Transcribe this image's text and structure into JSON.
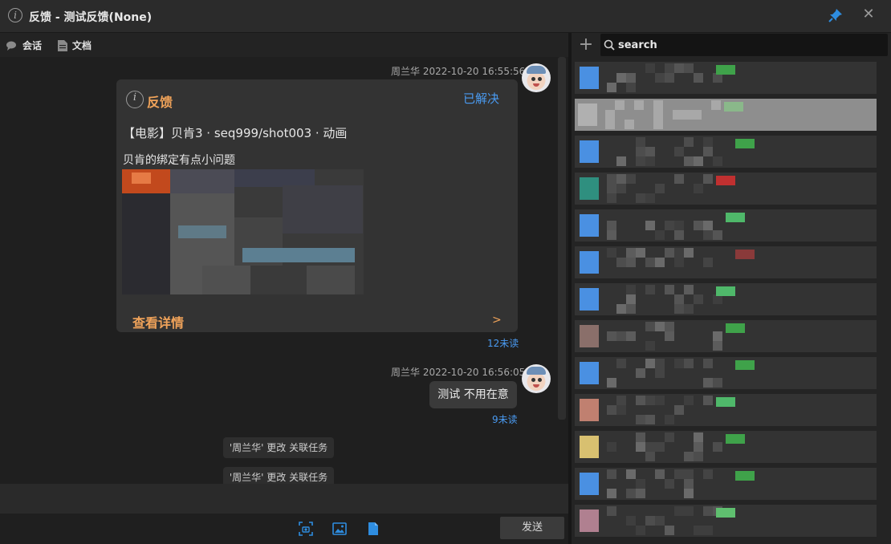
{
  "window": {
    "title": "反馈 - 测试反馈(None)"
  },
  "tabs": [
    {
      "label": "会话",
      "icon": "chat-bubble-icon"
    },
    {
      "label": "文档",
      "icon": "document-icon"
    }
  ],
  "messages": {
    "first": {
      "sender_time": "周兰华 2022-10-20 16:55:56",
      "card": {
        "title": "反馈",
        "status": "已解决",
        "line1": "【电影】贝肯3 · seq999/shot003 · 动画",
        "line2": "贝肯的绑定有点小问题",
        "detail_link": "查看详情",
        "arrow": ">"
      },
      "unread": "12未读"
    },
    "second": {
      "sender_time": "周兰华 2022-10-20 16:56:05",
      "text": "测试 不用在意",
      "unread": "9未读"
    },
    "system": [
      "'周兰华' 更改 关联任务",
      "'周兰华' 更改 关联任务"
    ]
  },
  "bottom": {
    "send_label": "发送",
    "icons": [
      "screenshot-icon",
      "image-icon",
      "file-icon"
    ]
  },
  "sidebar": {
    "search_placeholder": "search",
    "add_icon": "plus-icon",
    "item_count": 13,
    "selected_index": 1
  },
  "colors": {
    "accent_orange": "#f0a35a",
    "link_blue": "#4a9bf2",
    "pin_blue": "#2e8de0"
  }
}
